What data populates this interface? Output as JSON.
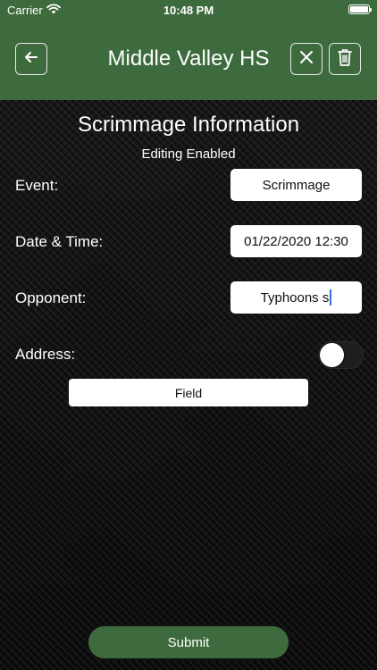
{
  "status_bar": {
    "carrier": "Carrier",
    "time": "10:48 PM"
  },
  "nav": {
    "title": "Middle Valley HS",
    "back_icon": "arrow-left-icon",
    "close_icon": "close-icon",
    "trash_icon": "trash-icon"
  },
  "form": {
    "title": "Scrimmage Information",
    "subtitle": "Editing Enabled",
    "event_label": "Event:",
    "event_value": "Scrimmage",
    "datetime_label": "Date & Time:",
    "datetime_value": "01/22/2020 12:30",
    "opponent_label": "Opponent:",
    "opponent_value": "Typhoons s",
    "address_label": "Address:",
    "address_toggle_on": false,
    "address_value": "Field"
  },
  "submit_label": "Submit",
  "colors": {
    "header_green": "#3e6b3e",
    "caret_blue": "#2f6ce5"
  }
}
